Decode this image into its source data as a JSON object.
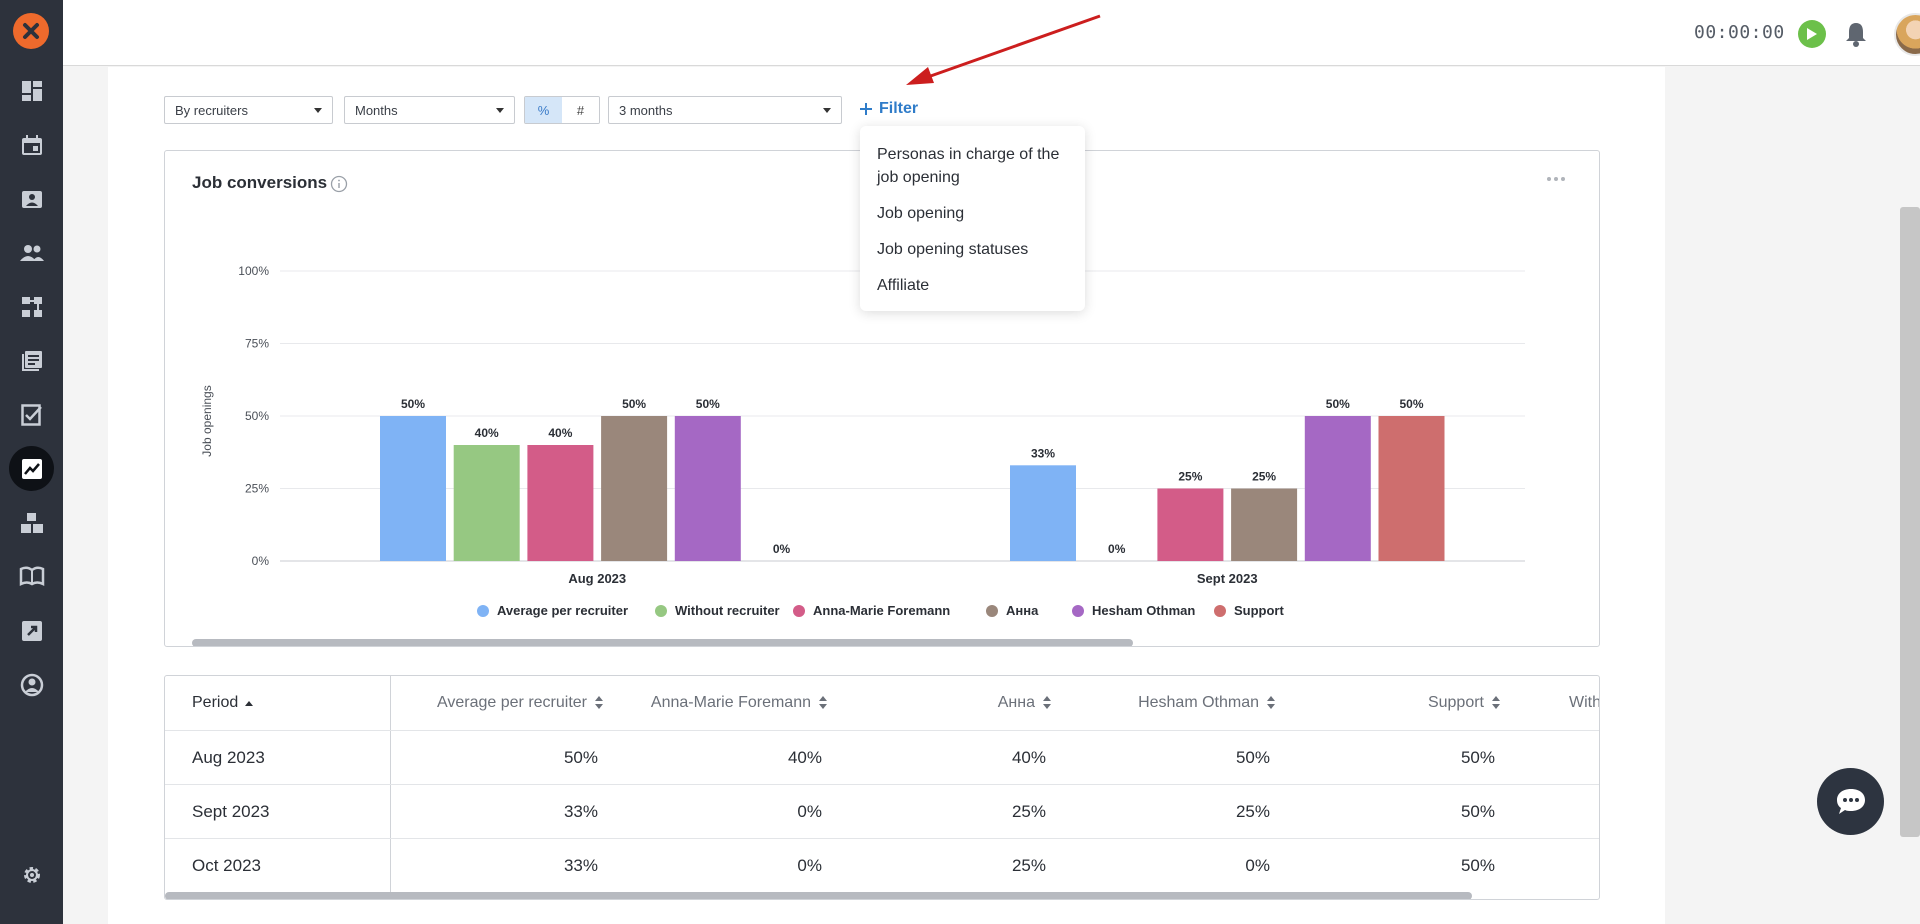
{
  "sidebar": {
    "items": [
      {
        "icon": "dashboard-icon"
      },
      {
        "icon": "calendar-icon"
      },
      {
        "icon": "contact-card-icon"
      },
      {
        "icon": "people-icon"
      },
      {
        "icon": "pipeline-icon"
      },
      {
        "icon": "documents-icon"
      },
      {
        "icon": "tasks-icon"
      },
      {
        "icon": "analytics-icon",
        "active": true
      },
      {
        "icon": "boxes-icon"
      },
      {
        "icon": "book-icon"
      },
      {
        "icon": "external-link-icon"
      },
      {
        "icon": "profile-icon"
      },
      {
        "icon": "gear-icon"
      }
    ]
  },
  "topbar": {
    "timer": "00:00:00"
  },
  "controls": {
    "group_by": "By recruiters",
    "period": "Months",
    "mode_percent": "%",
    "mode_count": "#",
    "range": "3 months",
    "filter_label": "Filter"
  },
  "filter_menu": {
    "items": [
      "Personas in charge of the job opening",
      "Job opening",
      "Job opening statuses",
      "Affiliate"
    ]
  },
  "card": {
    "title": "Job conversions"
  },
  "chart_data": {
    "type": "bar",
    "ylabel": "Job openings",
    "xlabel": "",
    "ylim": [
      0,
      100
    ],
    "yticks": [
      "0%",
      "25%",
      "50%",
      "75%",
      "100%"
    ],
    "categories": [
      "Aug 2023",
      "Sept 2023"
    ],
    "series": [
      {
        "name": "Average per recruiter",
        "color": "#7fb3f5",
        "values": [
          50,
          33
        ]
      },
      {
        "name": "Without recruiter",
        "color": "#96c882",
        "values": [
          40,
          0
        ]
      },
      {
        "name": "Anna-Marie Foremann",
        "color": "#d35c88",
        "values": [
          40,
          25
        ]
      },
      {
        "name": "Анна",
        "color": "#9a877b",
        "values": [
          50,
          25
        ]
      },
      {
        "name": "Hesham Othman",
        "color": "#a568c4",
        "values": [
          50,
          50
        ]
      },
      {
        "name": "Support",
        "color": "#ce6e6e",
        "values": [
          0,
          50
        ]
      }
    ],
    "legend_position": "bottom",
    "grid": true
  },
  "table": {
    "headers": {
      "period": "Period",
      "cols": [
        "Average per recruiter",
        "Anna-Marie Foremann",
        "Анна",
        "Hesham Othman",
        "Support",
        "With"
      ]
    },
    "rows": [
      {
        "period": "Aug 2023",
        "values": [
          "50%",
          "40%",
          "40%",
          "50%",
          "50%"
        ]
      },
      {
        "period": "Sept 2023",
        "values": [
          "33%",
          "0%",
          "25%",
          "25%",
          "50%"
        ]
      },
      {
        "period": "Oct 2023",
        "values": [
          "33%",
          "0%",
          "25%",
          "0%",
          "50%"
        ]
      }
    ]
  }
}
